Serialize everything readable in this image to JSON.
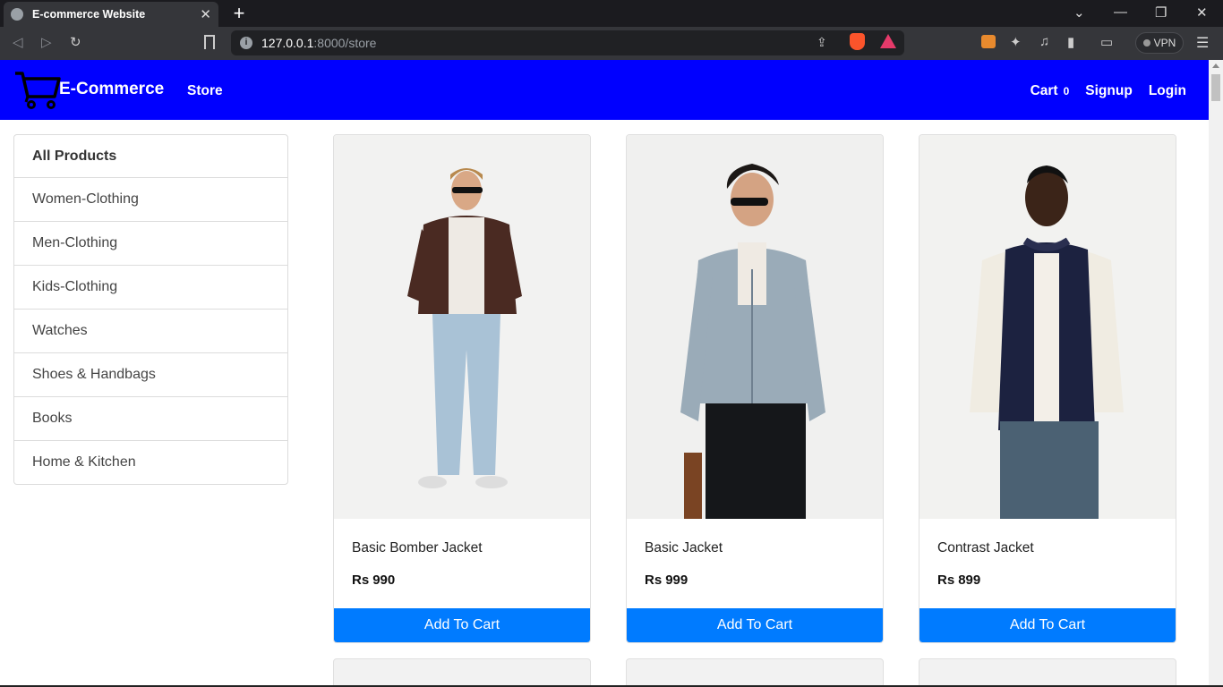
{
  "browser": {
    "tab_title": "E-commerce Website",
    "tab_close": "✕",
    "new_tab": "+",
    "url_host": "127.0.0.1",
    "url_rest": ":8000/store",
    "vpn_label": "VPN",
    "icons": [
      "back-icon",
      "forward-icon",
      "reload-icon",
      "bookmark-icon",
      "site-info-icon",
      "share-icon",
      "brave-shields-icon",
      "brave-rewards-icon",
      "metamask-icon",
      "extensions-icon",
      "media-icon",
      "sidebar-icon",
      "wallet-icon",
      "menu-icon"
    ]
  },
  "site": {
    "brand": "E-Commerce",
    "nav_store": "Store",
    "nav_cart": "Cart",
    "cart_count": "0",
    "nav_signup": "Signup",
    "nav_login": "Login",
    "brand_color": "#0000ff",
    "button_color": "#007bff"
  },
  "categories": [
    "All Products",
    "Women-Clothing",
    "Men-Clothing",
    "Kids-Clothing",
    "Watches",
    "Shoes & Handbags",
    "Books",
    "Home & Kitchen"
  ],
  "products": [
    {
      "name": "Basic Bomber Jacket",
      "currency": "Rs",
      "price": "990",
      "button": "Add To Cart"
    },
    {
      "name": "Basic Jacket",
      "currency": "Rs",
      "price": "999",
      "button": "Add To Cart"
    },
    {
      "name": "Contrast Jacket",
      "currency": "Rs",
      "price": "899",
      "button": "Add To Cart"
    }
  ]
}
